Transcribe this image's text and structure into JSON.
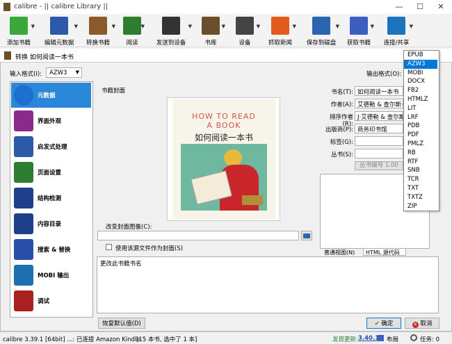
{
  "window": {
    "title": "calibre - || calibre Library ||"
  },
  "toolbar": [
    {
      "label": "添加书籍",
      "icon": "add-book-icon",
      "color": "#3aa83a"
    },
    {
      "label": "编辑元数据",
      "icon": "edit-metadata-icon",
      "color": "#2a5aa8"
    },
    {
      "label": "转换书籍",
      "icon": "convert-books-icon",
      "color": "#8b5a2b"
    },
    {
      "label": "阅读",
      "icon": "read-book-icon",
      "color": "#2e7d32"
    },
    {
      "label": "发送到设备",
      "icon": "send-to-device-icon",
      "color": "#333333"
    },
    {
      "label": "书库",
      "icon": "library-icon",
      "color": "#6b4f2a"
    },
    {
      "label": "设备",
      "icon": "device-icon",
      "color": "#444444"
    },
    {
      "label": "抓取新闻",
      "icon": "fetch-news-icon",
      "color": "#e35b1a"
    },
    {
      "label": "保存到磁盘",
      "icon": "save-to-disk-icon",
      "color": "#2a66b0"
    },
    {
      "label": "获取书籍",
      "icon": "get-books-icon",
      "color": "#3a5fc0"
    },
    {
      "label": "连接/共享",
      "icon": "connect-share-icon",
      "color": "#1e73be"
    }
  ],
  "dialog": {
    "title": "转换 如何阅读一本书",
    "input_format_label": "输入格式(I):",
    "input_format_value": "AZW3",
    "output_format_label": "输出格式(O):",
    "cover_section_label": "书籍封面",
    "change_cover_label": "改变封面图像(C):",
    "use_source_cover_label": "使用该源文件作为封面(S)",
    "cover": {
      "top_line": "HOW TO READ",
      "top_line2": "A BOOK",
      "cn_title": "如何阅读一本书"
    },
    "fields": [
      {
        "label": "书名(T):",
        "value": "如何阅读一本书"
      },
      {
        "label": "作者(A):",
        "value": "艾德勒 & 查尔斯·范"
      },
      {
        "label": "排序作者(R):",
        "value": "J·艾德勒 & 查尔斯"
      },
      {
        "label": "出版商(P):",
        "value": "商务印书馆"
      },
      {
        "label": "标签(G):",
        "value": ""
      },
      {
        "label": "丛书(S):",
        "value": ""
      }
    ],
    "series_number": "丛书编号 1.00",
    "comments_tabs": [
      "普通视图(N)",
      "HTML 源代码(H)"
    ],
    "help_text": "更改此书籍书名",
    "restore_defaults": "恢复默认值(D)",
    "ok": "确定",
    "cancel": "取消"
  },
  "sidebar": [
    {
      "label": "元数据",
      "icon": "metadata-info-icon",
      "active": true
    },
    {
      "label": "界面外观",
      "icon": "look-feel-brush-icon",
      "active": false
    },
    {
      "label": "启发式处理",
      "icon": "heuristics-icon",
      "active": false
    },
    {
      "label": "页面设置",
      "icon": "page-setup-tools-icon",
      "active": false
    },
    {
      "label": "结构检测",
      "icon": "structure-detect-icon",
      "active": false
    },
    {
      "label": "内容目录",
      "icon": "toc-icon",
      "active": false
    },
    {
      "label": "搜索 & 替换",
      "icon": "search-replace-icon",
      "active": false
    },
    {
      "label": "MOBI 输出",
      "icon": "mobi-output-icon",
      "active": false
    },
    {
      "label": "调试",
      "icon": "debug-bug-icon",
      "active": false
    }
  ],
  "formats": [
    "EPUB",
    "AZW3",
    "MOBI",
    "DOCX",
    "FB2",
    "HTMLZ",
    "LIT",
    "LRF",
    "PDB",
    "PDF",
    "PMLZ",
    "RB",
    "RTF",
    "SNB",
    "TCR",
    "TXT",
    "TXTZ",
    "ZIP"
  ],
  "selected_format": "AZW3",
  "status": {
    "left": "calibre 3.39.1 [64bit] ...: 已连接 Amazon Kindle",
    "count": "[15 本书, 选中了 1 本]",
    "update_label": "发现更新:",
    "update_version": "3.40.1",
    "layout": "布局",
    "jobs": "任务: 0"
  }
}
